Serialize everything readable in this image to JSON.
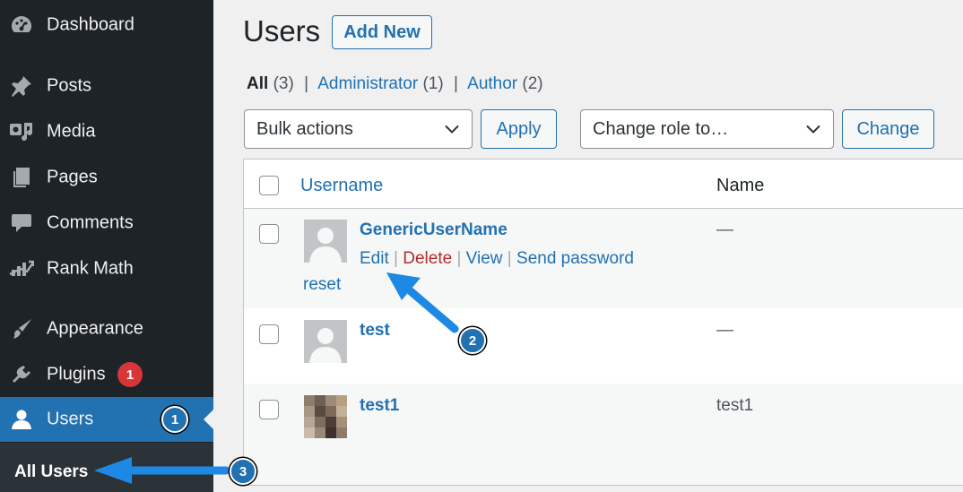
{
  "sidebar": {
    "items": [
      {
        "label": "Dashboard",
        "icon": "dashboard-icon"
      },
      {
        "label": "Posts",
        "icon": "pin-icon"
      },
      {
        "label": "Media",
        "icon": "media-icon"
      },
      {
        "label": "Pages",
        "icon": "pages-icon"
      },
      {
        "label": "Comments",
        "icon": "comment-icon"
      },
      {
        "label": "Rank Math",
        "icon": "rank-math-icon"
      },
      {
        "label": "Appearance",
        "icon": "brush-icon"
      },
      {
        "label": "Plugins",
        "icon": "plug-icon",
        "badge": "1"
      },
      {
        "label": "Users",
        "icon": "user-icon",
        "active": true
      }
    ],
    "submenu": {
      "all_users": "All Users"
    }
  },
  "annotations": {
    "step1": "1",
    "step2": "2",
    "step3": "3"
  },
  "page": {
    "title": "Users",
    "add_new": "Add New"
  },
  "filters": {
    "all": "All",
    "all_count": "(3)",
    "administrator": "Administrator",
    "administrator_count": "(1)",
    "author": "Author",
    "author_count": "(2)",
    "separator": "|"
  },
  "bulk": {
    "selected": "Bulk actions",
    "apply": "Apply"
  },
  "role": {
    "selected": "Change role to…",
    "change": "Change"
  },
  "table": {
    "headers": {
      "username": "Username",
      "name": "Name"
    },
    "rows": [
      {
        "username": "GenericUserName",
        "name": "—"
      },
      {
        "username": "test",
        "name": "—"
      },
      {
        "username": "test1",
        "name": "test1"
      }
    ],
    "row_actions": {
      "edit": "Edit",
      "delete": "Delete",
      "view": "View",
      "send_password": "Send password",
      "reset": "reset"
    }
  },
  "colors": {
    "sidebar_bg": "#1d2327",
    "accent": "#2271b1",
    "badge": "#d63638",
    "delete": "#b32d2e"
  }
}
